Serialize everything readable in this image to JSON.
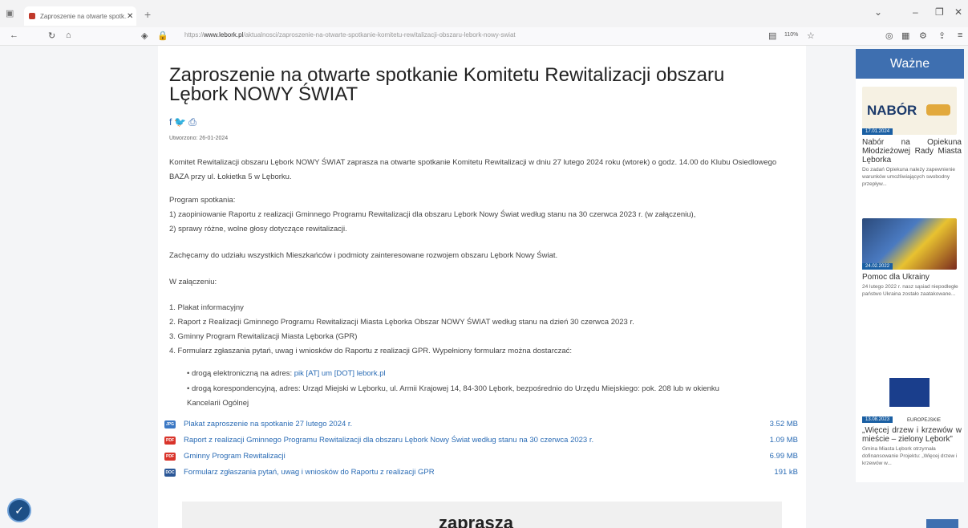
{
  "browser": {
    "tab_title": "Zaproszenie na otwarte spotk...",
    "tab_close": "✕",
    "new_tab": "+",
    "url_prefix": "https://",
    "url_domain": "www.lebork.pl",
    "url_path": "/aktualnosci/zaproszenie-na-otwarte-spotkanie-komitetu-rewitalizacji-obszaru-lebork-nowy-swiat",
    "zoom": "110%"
  },
  "page": {
    "title": "Zaproszenie na otwarte spotkanie Komitetu Rewitalizacji obszaru Lębork NOWY ŚWIAT",
    "date": "Utworzono: 26-01-2024",
    "intro": "Komitet Rewitalizacji obszaru Lębork NOWY ŚWIAT zaprasza na otwarte spotkanie Komitetu Rewitalizacji w dniu 27 lutego 2024 roku (wtorek) o godz. 14.00 do Klubu Osiedlowego BAZA przy ul. Łokietka 5 w Lęborku.",
    "program_label": "Program spotkania:",
    "program_1": "1)   zaopiniowanie Raportu z realizacji Gminnego Programu Rewitalizacji dla obszaru Lębork Nowy Świat według stanu na 30 czerwca 2023 r. (w załączeniu),",
    "program_2": "2)   sprawy różne, wolne głosy dotyczące rewitalizacji.",
    "encourage": "Zachęcamy do udziału wszystkich Mieszkańców i podmioty zainteresowane rozwojem obszaru Lębork Nowy Świat.",
    "attachments_label": "W załączeniu:",
    "list_1": "1. Plakat informacyjny",
    "list_2": "2. Raport z Realizacji Gminnego Programu Rewitalizacji Miasta Lęborka Obszar NOWY ŚWIAT według stanu na dzień 30 czerwca 2023 r.",
    "list_3": "3. Gminny Program Rewitalizacji Miasta Lęborka (GPR)",
    "list_4": "4. Formularz zgłaszania pytań, uwag i wniosków do Raportu z realizacji GPR. Wypełniony formularz można dostarczać:",
    "bullet_1_pre": "• drogą elektroniczną na adres: ",
    "bullet_1_link": "pik [AT] um [DOT] lebork.pl",
    "bullet_2": "• drogą korespondencyjną, adres: Urząd Miejski w Lęborku, ul. Armii Krajowej 14, 84-300 Lębork, bezpośrednio do Urzędu Miejskiego: pok. 208 lub w okienku",
    "bullet_2b": "Kancelarii Ogólnej",
    "files": [
      {
        "label": "Plakat zaproszenie na spotkanie 27 lutego 2024 r.",
        "size": "3.52 MB",
        "type": "JPG",
        "color": "#3b78c4"
      },
      {
        "label": "Raport z realizacji Gminnego Programu Rewitalizacji dla obszaru Lębork Nowy Świat według stanu na 30 czerwca 2023 r.",
        "size": "1.09 MB",
        "type": "PDF",
        "color": "#d9342b"
      },
      {
        "label": "Gminny Program Rewitalizacji",
        "size": "6.99 MB",
        "type": "PDF",
        "color": "#d9342b"
      },
      {
        "label": "Formularz zgłaszania pytań, uwag i wniosków do Raportu z realizacji GPR",
        "size": "191 kB",
        "type": "DOC",
        "color": "#2b5797"
      }
    ],
    "poster_text": "zaprasza"
  },
  "sidebar": {
    "heading": "Ważne",
    "items": [
      {
        "badge": "17.01.2024",
        "banner": "NABÓR",
        "title": "Nabór na Opiekuna Młodzieżowej Rady Miasta Lęborka",
        "desc": "Do zadań Opiekuna należy zapewnienie warunków umożliwiających swobodny przepływ..."
      },
      {
        "badge": "24.02.2022",
        "title": "Pomoc dla Ukrainy",
        "desc": "24 lutego 2022 r. nasz sąsiad niepodległe państwo Ukraina zostało zaatakowane..."
      },
      {
        "badge": "13.08.2023",
        "banner": "EUROPEJSKIE",
        "title": "„Więcej drzew i krzewów w mieście – zielony Lębork”",
        "desc": "Gmina Miasta Lębork otrzymała dofinansowanie Projektu: „Więcej drzew i krzewów w..."
      }
    ]
  },
  "colors": {
    "accent": "#3e6fb0",
    "link": "#2b6cb5"
  }
}
